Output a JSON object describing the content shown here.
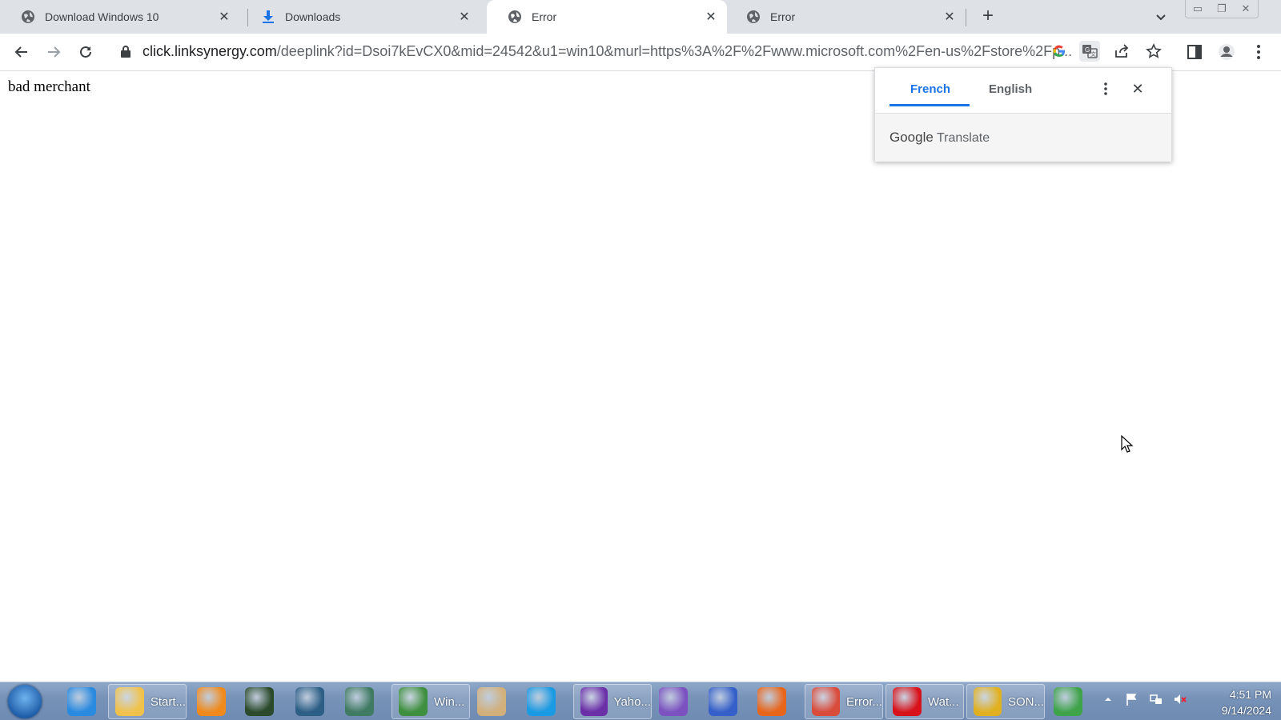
{
  "tabs": [
    {
      "title": "Download Windows 10",
      "icon": "globe-icon"
    },
    {
      "title": "Downloads",
      "icon": "download-icon"
    },
    {
      "title": "Error",
      "icon": "globe-icon",
      "active": true
    },
    {
      "title": "Error",
      "icon": "globe-icon"
    }
  ],
  "window_controls": {
    "minimize": "▭",
    "restore": "❐",
    "close": "✕"
  },
  "address_bar": {
    "domain": "click.linksynergy.com",
    "path": "/deeplink?id=Dsoi7kEvCX0&mid=24542&u1=win10&murl=https%3A%2F%2Fwww.microsoft.com%2Fen-us%2Fstore%2Fp..."
  },
  "page": {
    "body_text": "bad merchant"
  },
  "translate_popup": {
    "source_language": "French",
    "target_language": "English",
    "brand_google": "Google",
    "brand_translate": "Translate"
  },
  "taskbar": {
    "items": [
      {
        "label": "",
        "icon": "internet-explorer-icon",
        "color": "#2a8ae0"
      },
      {
        "label": "Start...",
        "icon": "folder-icon",
        "color": "#f0c24b",
        "button": true
      },
      {
        "label": "",
        "icon": "media-player-icon",
        "color": "#f08a1c"
      },
      {
        "label": "",
        "icon": "terminal-icon",
        "color": "#2b4a2b"
      },
      {
        "label": "",
        "icon": "steam-icon",
        "color": "#2d5f86"
      },
      {
        "label": "",
        "icon": "window-app-icon",
        "color": "#3f7a62"
      },
      {
        "label": "Win...",
        "icon": "users-icon",
        "color": "#3e8f3e",
        "button": true
      },
      {
        "label": "",
        "icon": "paint-icon",
        "color": "#d1b07c"
      },
      {
        "label": "",
        "icon": "edge-icon",
        "color": "#1a9ae2"
      },
      {
        "label": "Yaho...",
        "icon": "yahoo-messenger-icon",
        "color": "#6b2fa8",
        "button": true
      },
      {
        "label": "",
        "icon": "visual-studio-icon",
        "color": "#7b52c0"
      },
      {
        "label": "",
        "icon": "flame-icon",
        "color": "#3560c9"
      },
      {
        "label": "",
        "icon": "firefox-icon",
        "color": "#e8661b"
      },
      {
        "label": "Error...",
        "icon": "chrome-icon",
        "color": "#d94b3b",
        "button": true
      },
      {
        "label": "Wat...",
        "icon": "opera-icon",
        "color": "#d8121a",
        "button": true
      },
      {
        "label": "SON...",
        "icon": "sonic-icon",
        "color": "#e0b020",
        "button": true
      },
      {
        "label": "",
        "icon": "windows-flag-icon",
        "color": "#3fa34a"
      }
    ],
    "clock": {
      "time": "4:51 PM",
      "date": "9/14/2024"
    }
  }
}
